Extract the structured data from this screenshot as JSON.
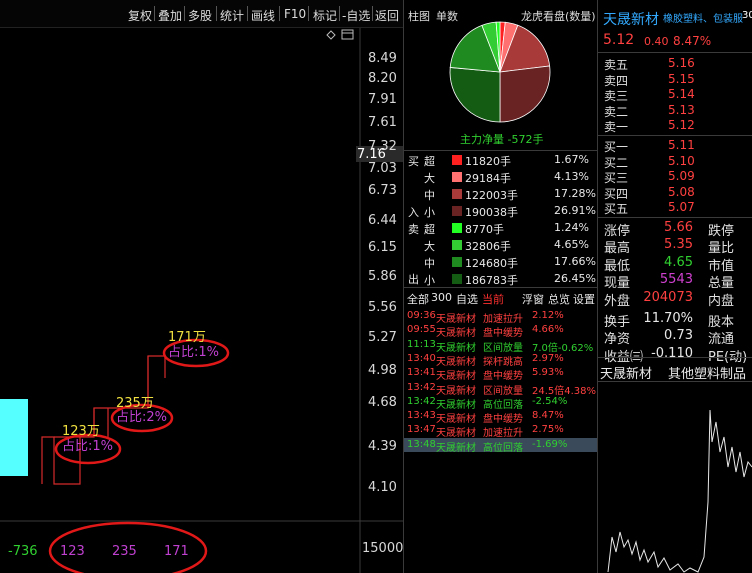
{
  "toolbar": {
    "items": [
      "复权",
      "叠加",
      "多股",
      "统计",
      "画线",
      "F10",
      "标记",
      "-自选",
      "返回"
    ]
  },
  "chart": {
    "price_ticks": [
      "8.49",
      "8.20",
      "7.91",
      "7.61",
      "7.32",
      "7.03",
      "6.73",
      "6.44",
      "6.15",
      "5.86",
      "5.56",
      "5.27",
      "4.98",
      "4.68",
      "4.39",
      "4.10"
    ],
    "current_price_tag": "7.16",
    "volume_tick": "15000",
    "annotations": [
      {
        "amount": "123万",
        "ratio": "占比:1%"
      },
      {
        "amount": "235万",
        "ratio": "占比:2%"
      },
      {
        "amount": "171万",
        "ratio": "占比:1%"
      }
    ],
    "bottom_values": [
      "-736",
      "123",
      "235",
      "171"
    ]
  },
  "fund_panel": {
    "tabs": [
      "柱图",
      "单数"
    ],
    "title": "龙虎看盘(数量)",
    "net_label": "主力净量 -572手",
    "buy_label": "买",
    "sell_label": "卖",
    "in_label": "入",
    "out_label": "出",
    "rows": [
      {
        "side": "",
        "level": "超",
        "amount": "11820手",
        "pct": "1.67%",
        "color": "#ff2020"
      },
      {
        "side": "",
        "level": "大",
        "amount": "29184手",
        "pct": "4.13%",
        "color": "#ff7070"
      },
      {
        "side": "",
        "level": "中",
        "amount": "122003手",
        "pct": "17.28%",
        "color": "#a83a3a"
      },
      {
        "side": "",
        "level": "小",
        "amount": "190038手",
        "pct": "26.91%",
        "color": "#6a2323"
      },
      {
        "side": "",
        "level": "超",
        "amount": "8770手",
        "pct": "1.24%",
        "color": "#22ff22"
      },
      {
        "side": "",
        "level": "大",
        "amount": "32806手",
        "pct": "4.65%",
        "color": "#33cc33"
      },
      {
        "side": "",
        "level": "中",
        "amount": "124680手",
        "pct": "17.66%",
        "color": "#1f8a1f"
      },
      {
        "side": "",
        "level": "小",
        "amount": "186783手",
        "pct": "26.45%",
        "color": "#145c14"
      }
    ],
    "pie_slices": [
      {
        "value": 1.67,
        "color": "#ff2020"
      },
      {
        "value": 4.13,
        "color": "#ff7070"
      },
      {
        "value": 17.28,
        "color": "#a83a3a"
      },
      {
        "value": 26.91,
        "color": "#6a2323"
      },
      {
        "value": 26.45,
        "color": "#145c14"
      },
      {
        "value": 17.66,
        "color": "#1f8a1f"
      },
      {
        "value": 4.65,
        "color": "#33cc33"
      },
      {
        "value": 1.24,
        "color": "#22ff22"
      }
    ]
  },
  "alerts": {
    "tabs": [
      "全部",
      "300",
      "自选",
      "当前"
    ],
    "right_tabs": [
      "浮窗",
      "总览",
      "设置"
    ],
    "rows": [
      {
        "time": "09:36",
        "name": "天晟新材",
        "event": "加速拉升",
        "value": "2.12%",
        "color": "#ff4040"
      },
      {
        "time": "09:55",
        "name": "天晟新材",
        "event": "盘中缓势",
        "value": "4.66%",
        "color": "#ff4040"
      },
      {
        "time": "11:13",
        "name": "天晟新材",
        "event": "区间放量",
        "value": "7.0倍-0.62%",
        "color": "#30d030"
      },
      {
        "time": "13:40",
        "name": "天晟新材",
        "event": "探杆跳高",
        "value": "2.97%",
        "color": "#ff4040"
      },
      {
        "time": "13:41",
        "name": "天晟新材",
        "event": "盘中缓势",
        "value": "5.93%",
        "color": "#ff4040"
      },
      {
        "time": "13:42",
        "name": "天晟新材",
        "event": "区间放量",
        "value": "24.5倍4.38%",
        "color": "#ff4040"
      },
      {
        "time": "13:42",
        "name": "天晟新材",
        "event": "高位回落",
        "value": "-2.54%",
        "color": "#30d030"
      },
      {
        "time": "13:43",
        "name": "天晟新材",
        "event": "盘中缓势",
        "value": "8.47%",
        "color": "#ff4040"
      },
      {
        "time": "13:47",
        "name": "天晟新材",
        "event": "加速拉升",
        "value": "2.75%",
        "color": "#ff4040"
      },
      {
        "time": "13:48",
        "name": "天晟新材",
        "event": "高位回落",
        "value": "-1.69%",
        "color": "#30d030"
      }
    ]
  },
  "quote": {
    "name": "天晟新材",
    "industry": "橡胶塑料、包装服务商、汽车类",
    "industry_suffix": "30",
    "price": "5.12",
    "change": "0.40",
    "change_pct": "8.47%",
    "asks": [
      {
        "label": "卖五",
        "price": "5.16"
      },
      {
        "label": "卖四",
        "price": "5.15"
      },
      {
        "label": "卖三",
        "price": "5.14"
      },
      {
        "label": "卖二",
        "price": "5.13"
      },
      {
        "label": "卖一",
        "price": "5.12"
      }
    ],
    "bids": [
      {
        "label": "买一",
        "price": "5.11"
      },
      {
        "label": "买二",
        "price": "5.10"
      },
      {
        "label": "买三",
        "price": "5.09"
      },
      {
        "label": "买四",
        "price": "5.08"
      },
      {
        "label": "买五",
        "price": "5.07"
      }
    ],
    "stats": [
      {
        "label": "涨停",
        "value": "5.66",
        "color": "#ff4040",
        "label2": "跌停"
      },
      {
        "label": "最高",
        "value": "5.35",
        "color": "#ff4040",
        "label2": "量比"
      },
      {
        "label": "最低",
        "value": "4.65",
        "color": "#30d030",
        "label2": "市值"
      },
      {
        "label": "现量",
        "value": "5543",
        "color": "#d040d0",
        "label2": "总量"
      },
      {
        "label": "外盘",
        "value": "204073",
        "color": "#ff4040",
        "label2": "内盘"
      },
      {
        "label": "换手",
        "value": "11.70%",
        "color": "#e8e8e8",
        "label2": "股本"
      },
      {
        "label": "净资",
        "value": "0.73",
        "color": "#e8e8e8",
        "label2": "流通"
      },
      {
        "label": "收益㈢",
        "value": "-0.110",
        "color": "#e8e8e8",
        "label2": "PE(动)"
      }
    ],
    "footer_name": "天晟新材",
    "footer_industry": "其他塑料制品"
  }
}
